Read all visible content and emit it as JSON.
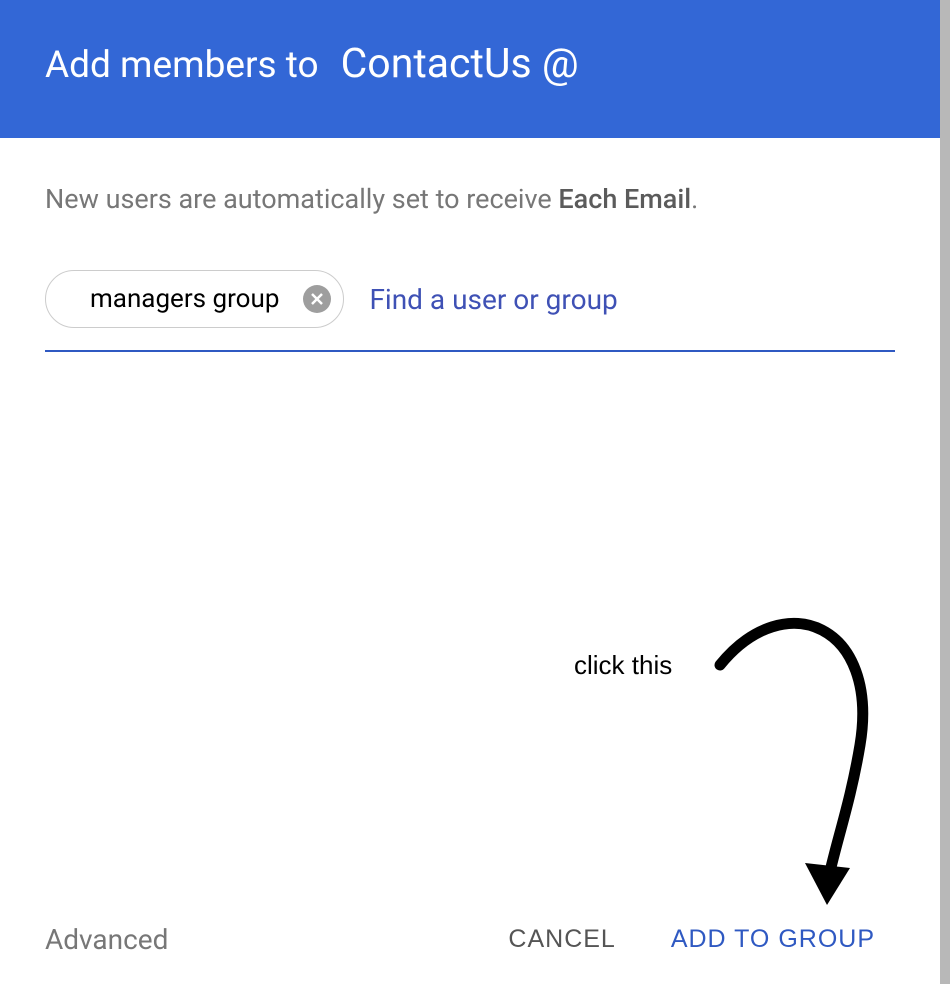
{
  "header": {
    "prefix": "Add members to",
    "group_name": "ContactUs @"
  },
  "info": {
    "text_before": "New users are automatically set to receive ",
    "bold": "Each Email",
    "text_after": "."
  },
  "search": {
    "chip_value": "managers group",
    "placeholder": "Find a user or group",
    "close_icon": "close-icon"
  },
  "footer": {
    "advanced_label": "Advanced",
    "cancel_label": "CANCEL",
    "add_label": "ADD TO GROUP"
  },
  "annotation": {
    "text": "click this"
  }
}
